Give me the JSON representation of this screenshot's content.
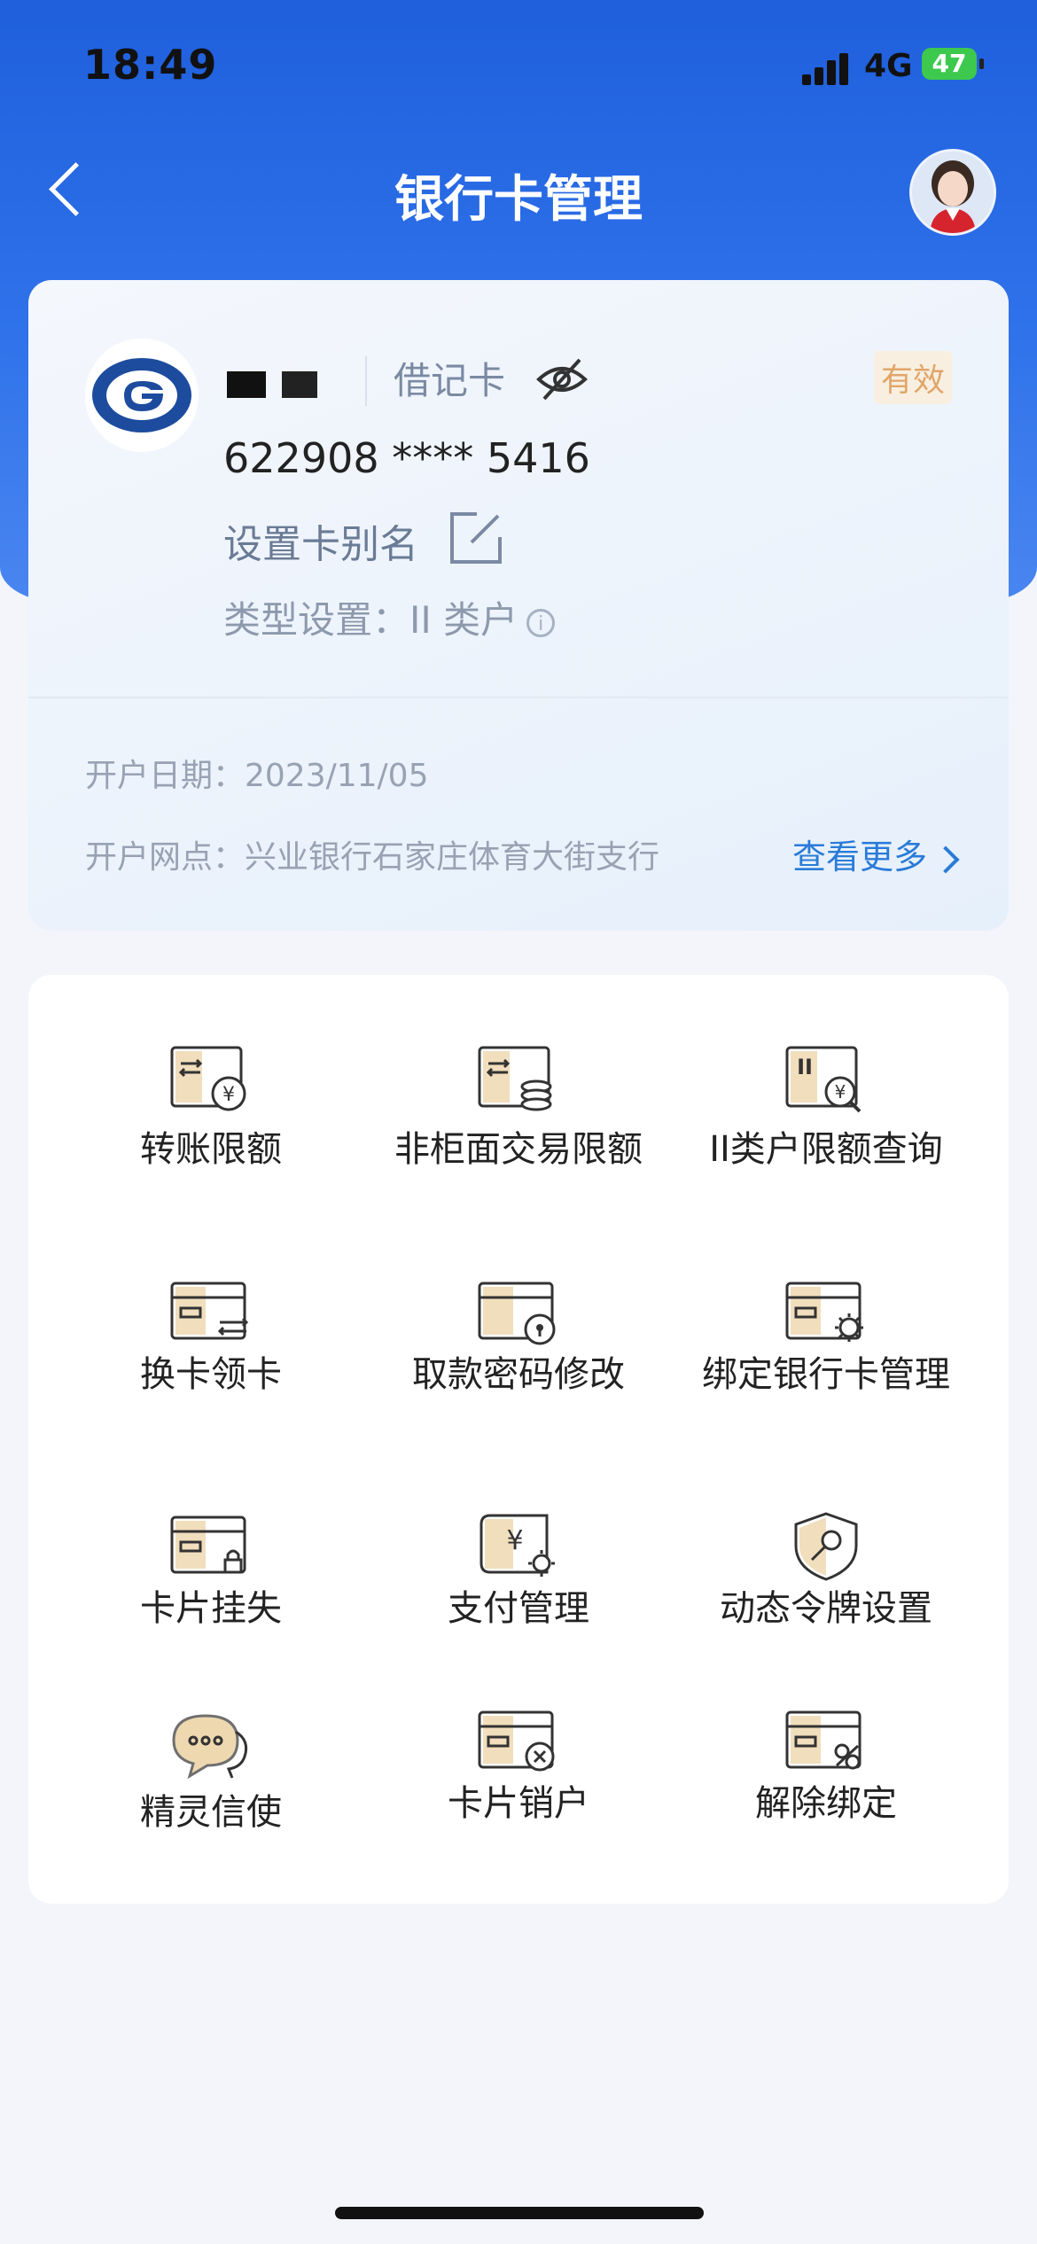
{
  "status_bar": {
    "time": "18:49",
    "network": "4G",
    "battery": "47"
  },
  "header": {
    "title": "银行卡管理"
  },
  "card": {
    "type_label": "借记卡",
    "status": "有效",
    "number": "622908 **** 5416",
    "alias_action": "设置卡别名",
    "type_setting": "类型设置：II 类户",
    "open_date": "开户日期：2023/11/05",
    "open_branch": "开户网点：兴业银行石家庄体育大街支行",
    "more_link": "查看更多"
  },
  "functions": [
    {
      "label": "转账限额",
      "icon": "transfer-limit-icon"
    },
    {
      "label": "非柜面交易限额",
      "icon": "non-counter-limit-icon"
    },
    {
      "label": "II类户限额查询",
      "icon": "class2-limit-query-icon"
    },
    {
      "label": "换卡领卡",
      "icon": "replace-card-icon"
    },
    {
      "label": "取款密码修改",
      "icon": "withdraw-password-icon"
    },
    {
      "label": "绑定银行卡管理",
      "icon": "bind-card-settings-icon"
    },
    {
      "label": "卡片挂失",
      "icon": "card-lock-icon"
    },
    {
      "label": "支付管理",
      "icon": "payment-settings-icon"
    },
    {
      "label": "动态令牌设置",
      "icon": "token-shield-icon"
    },
    {
      "label": "精灵信使",
      "icon": "chat-bubble-icon"
    },
    {
      "label": "卡片销户",
      "icon": "card-close-icon"
    },
    {
      "label": "解除绑定",
      "icon": "unbind-card-icon"
    }
  ],
  "colors": {
    "header_blue": "#2f72ea",
    "link_blue": "#2a7bd8",
    "badge_text": "#e0a66a",
    "icon_gold": "#e8c88f"
  }
}
